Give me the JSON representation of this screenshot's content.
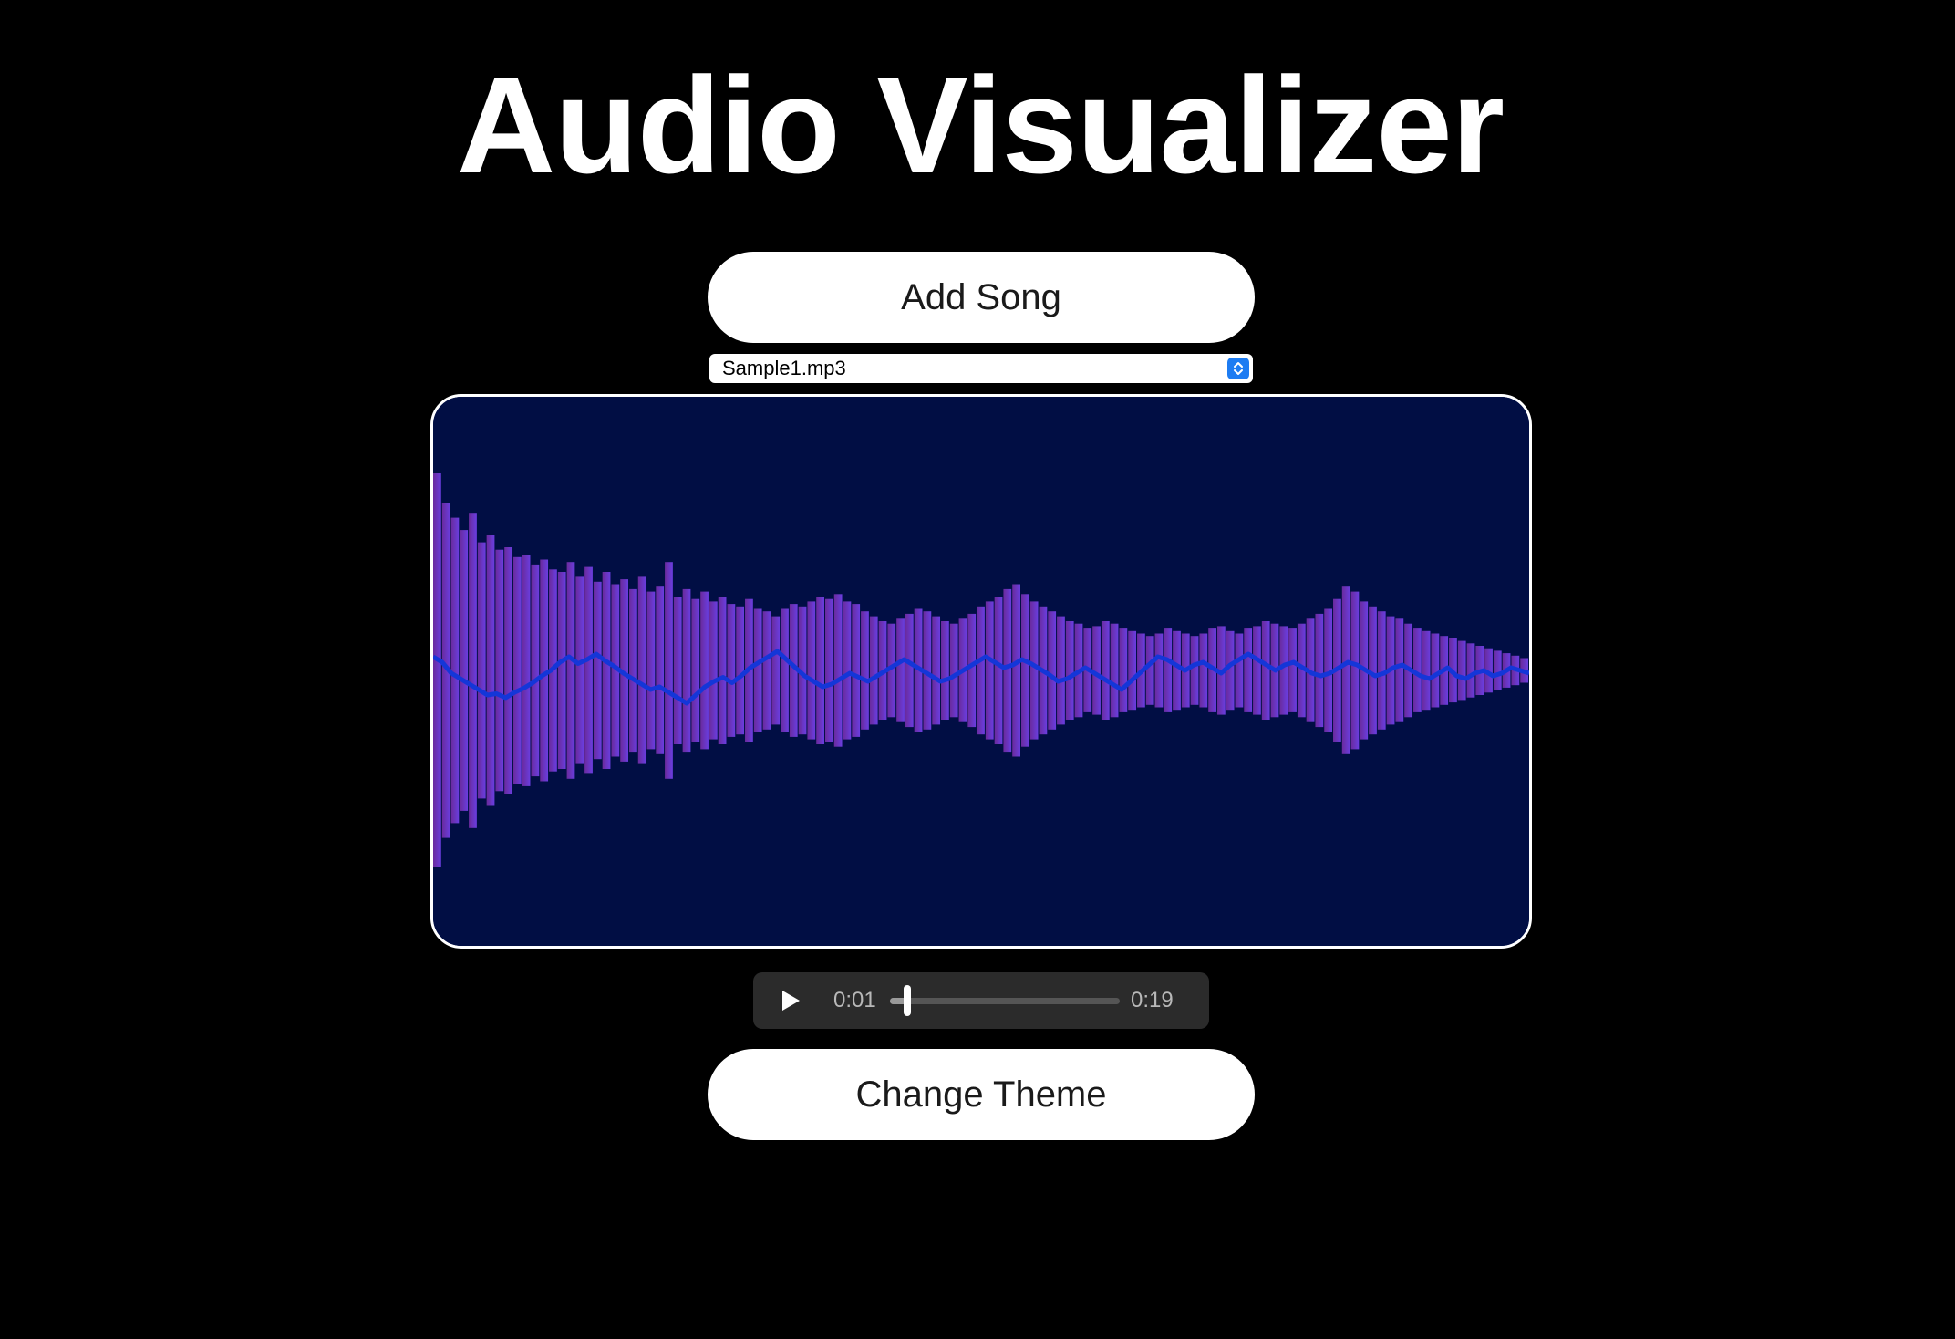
{
  "header": {
    "title": "Audio Visualizer"
  },
  "controls": {
    "add_song_label": "Add Song",
    "song_select": {
      "selected": "Sample1.mp3"
    },
    "change_theme_label": "Change Theme"
  },
  "player": {
    "current_time": "0:01",
    "duration": "0:19",
    "progress": 0.06,
    "play_icon": "play-icon"
  },
  "visualizer": {
    "background_color": "#010e44",
    "bar_color_start": "#6a2a9c",
    "bar_color_end": "#6a3ee0",
    "line_color": "#1436d8",
    "bar_amplitudes": [
      0.8,
      0.68,
      0.62,
      0.57,
      0.64,
      0.52,
      0.55,
      0.49,
      0.5,
      0.46,
      0.47,
      0.43,
      0.45,
      0.41,
      0.4,
      0.44,
      0.38,
      0.42,
      0.36,
      0.4,
      0.35,
      0.37,
      0.33,
      0.38,
      0.32,
      0.34,
      0.44,
      0.3,
      0.33,
      0.29,
      0.32,
      0.28,
      0.3,
      0.27,
      0.26,
      0.29,
      0.25,
      0.24,
      0.22,
      0.25,
      0.27,
      0.26,
      0.28,
      0.3,
      0.29,
      0.31,
      0.28,
      0.27,
      0.24,
      0.22,
      0.2,
      0.19,
      0.21,
      0.23,
      0.25,
      0.24,
      0.22,
      0.2,
      0.19,
      0.21,
      0.23,
      0.26,
      0.28,
      0.3,
      0.33,
      0.35,
      0.31,
      0.28,
      0.26,
      0.24,
      0.22,
      0.2,
      0.19,
      0.17,
      0.18,
      0.2,
      0.19,
      0.17,
      0.16,
      0.15,
      0.14,
      0.15,
      0.17,
      0.16,
      0.15,
      0.14,
      0.15,
      0.17,
      0.18,
      0.16,
      0.15,
      0.17,
      0.18,
      0.2,
      0.19,
      0.18,
      0.17,
      0.19,
      0.21,
      0.23,
      0.25,
      0.29,
      0.34,
      0.32,
      0.28,
      0.26,
      0.24,
      0.22,
      0.21,
      0.19,
      0.17,
      0.16,
      0.15,
      0.14,
      0.13,
      0.12,
      0.11,
      0.1,
      0.09,
      0.08,
      0.07,
      0.06,
      0.05
    ],
    "line_offsets": [
      0.1,
      0.06,
      -0.02,
      -0.06,
      -0.1,
      -0.14,
      -0.18,
      -0.17,
      -0.2,
      -0.16,
      -0.13,
      -0.09,
      -0.04,
      0.0,
      0.06,
      0.1,
      0.05,
      0.08,
      0.12,
      0.07,
      0.03,
      -0.02,
      -0.06,
      -0.1,
      -0.14,
      -0.12,
      -0.16,
      -0.2,
      -0.24,
      -0.18,
      -0.12,
      -0.08,
      -0.05,
      -0.09,
      -0.04,
      0.02,
      0.06,
      0.1,
      0.14,
      0.08,
      0.02,
      -0.04,
      -0.08,
      -0.12,
      -0.1,
      -0.06,
      -0.02,
      -0.05,
      -0.08,
      -0.04,
      0.0,
      0.04,
      0.08,
      0.04,
      0.0,
      -0.04,
      -0.08,
      -0.06,
      -0.02,
      0.02,
      0.06,
      0.1,
      0.06,
      0.02,
      0.04,
      0.08,
      0.05,
      0.01,
      -0.03,
      -0.08,
      -0.06,
      -0.02,
      0.02,
      -0.02,
      -0.06,
      -0.1,
      -0.14,
      -0.08,
      -0.02,
      0.04,
      0.1,
      0.08,
      0.04,
      0.0,
      0.04,
      0.06,
      0.02,
      -0.02,
      0.04,
      0.08,
      0.12,
      0.08,
      0.04,
      0.0,
      0.04,
      0.06,
      0.02,
      -0.02,
      -0.04,
      -0.02,
      0.02,
      0.06,
      0.04,
      0.0,
      -0.04,
      -0.02,
      0.02,
      0.04,
      0.0,
      -0.04,
      -0.06,
      -0.02,
      0.02,
      -0.04,
      -0.06,
      -0.02,
      0.0,
      -0.04,
      -0.02,
      0.02,
      0.0,
      -0.02
    ]
  }
}
